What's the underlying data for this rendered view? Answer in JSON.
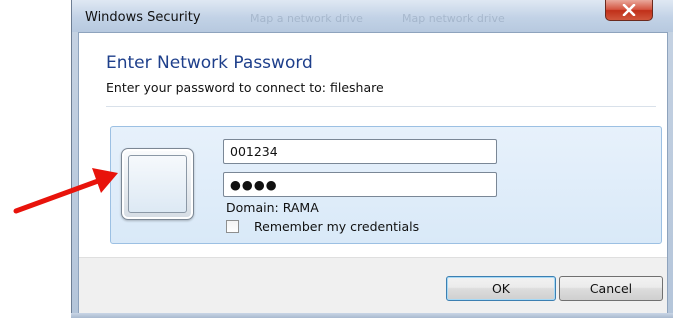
{
  "window": {
    "title": "Windows Security",
    "ghost_titles": [
      "Map a network drive",
      "Map network drive"
    ],
    "close_icon": "close-icon"
  },
  "dialog": {
    "heading": "Enter Network Password",
    "subheading": "Enter your password to connect to: fileshare",
    "username_value": "001234",
    "password_value": "●●●●",
    "domain_text": "Domain: RAMA",
    "remember_label": "Remember my credentials",
    "remember_checked": false
  },
  "buttons": {
    "ok": "OK",
    "cancel": "Cancel"
  },
  "annotation": {
    "arrow_icon": "red-arrow-annotation",
    "arrow_color": "#e8130b"
  },
  "colors": {
    "heading": "#1e3f8b",
    "tile_background": "#dcebf9",
    "close_button": "#c9432c"
  }
}
